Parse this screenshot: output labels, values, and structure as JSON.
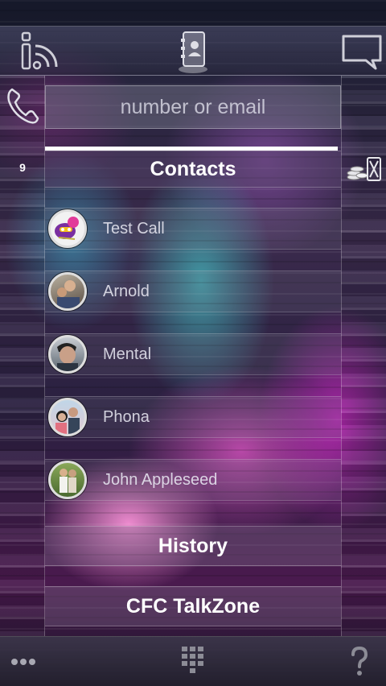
{
  "search": {
    "placeholder": "number or email",
    "value": ""
  },
  "contacts": {
    "count": "9",
    "header": "Contacts",
    "items": [
      {
        "name": "Test Call",
        "avatar_color": "#ffffff"
      },
      {
        "name": "Arnold",
        "avatar_color": "#8a7a6a"
      },
      {
        "name": "Mental",
        "avatar_color": "#6a7580"
      },
      {
        "name": "Phona",
        "avatar_color": "#a06070"
      },
      {
        "name": "John Appleseed",
        "avatar_color": "#6a8a4a"
      }
    ]
  },
  "nav": {
    "history": "History",
    "talkzone": "CFC TalkZone"
  },
  "icons": {
    "top_left": "info-feed-icon",
    "top_center": "contacts-book-icon",
    "top_right": "message-bubble-icon",
    "left": "phone-handset-icon",
    "right": "coins-chat-icon",
    "bottom_left": "more-dots-icon",
    "bottom_center": "keypad-icon",
    "bottom_right": "help-icon"
  }
}
